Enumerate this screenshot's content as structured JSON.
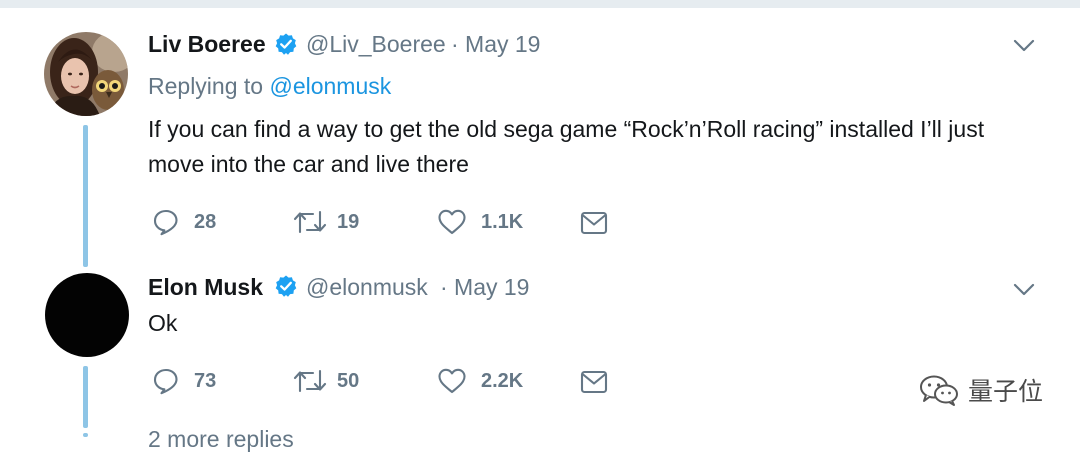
{
  "tweets": [
    {
      "name": "Liv Boeree",
      "handle": "@Liv_Boeree",
      "date": "· May 19",
      "reply_prefix": "Replying to ",
      "reply_to": "@elonmusk",
      "text": "If you can find a way to get the old sega game “Rock’n’Roll racing” installed I’ll just move into the car and live there",
      "replies": "28",
      "retweets": "19",
      "likes": "1.1K"
    },
    {
      "name": "Elon Musk",
      "handle": "@elonmusk",
      "date": "· May 19",
      "text": "Ok",
      "replies": "73",
      "retweets": "50",
      "likes": "2.2K"
    }
  ],
  "watermark": {
    "text": "量子位"
  },
  "truncated_line": "2 more replies",
  "colors": {
    "accent": "#1b95e0",
    "thread_line": "#8ec5e6",
    "muted": "#657786",
    "text": "#14171a"
  },
  "icons": [
    "verified-badge-icon",
    "chevron-down-icon",
    "reply-icon",
    "retweet-icon",
    "like-heart-icon",
    "direct-message-icon",
    "wechat-icon"
  ]
}
